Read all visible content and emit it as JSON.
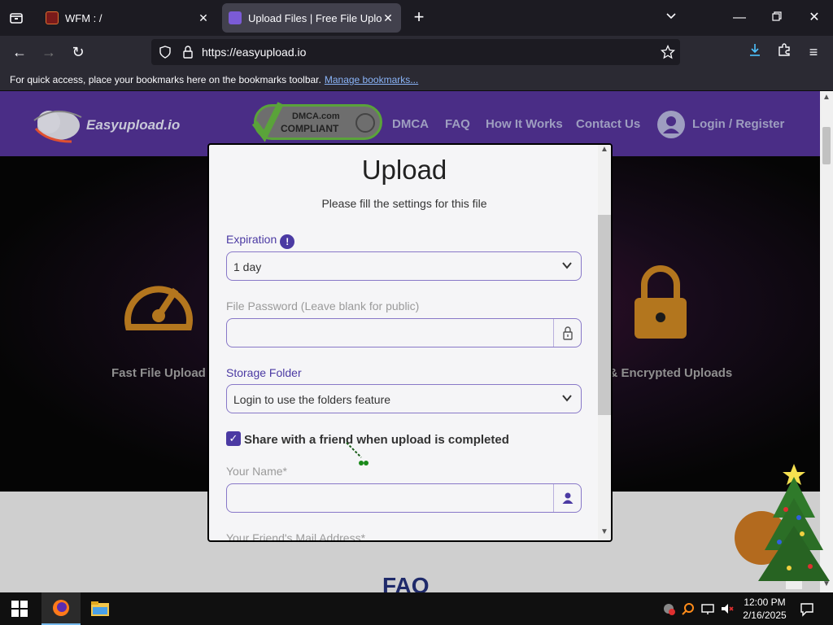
{
  "browser": {
    "tabs": [
      {
        "title": "WFM : /",
        "active": false
      },
      {
        "title": "Upload Files | Free File Upload a",
        "active": true
      }
    ],
    "url": "https://easyupload.io",
    "bookmarks_hint": "For quick access, place your bookmarks here on the bookmarks toolbar.",
    "bookmarks_link": "Manage bookmarks..."
  },
  "site": {
    "logo": "Easyupload.io",
    "dmca_line1": "DMCA.com",
    "dmca_line2": "COMPLIANT",
    "menu": [
      "DMCA",
      "FAQ",
      "How It Works",
      "Contact Us"
    ],
    "login": "Login / Register",
    "feature_left": "Fast File Upload",
    "feature_right": "e & Encrypted Uploads",
    "faq_heading": "FAQ"
  },
  "modal": {
    "title": "Upload",
    "subtitle": "Please fill the settings for this file",
    "expiration_label": "Expiration",
    "expiration_value": "1 day",
    "password_label": "File Password (Leave blank for public)",
    "storage_label": "Storage Folder",
    "storage_value": "Login to use the folders feature",
    "share_label": "Share with a friend when upload is completed",
    "your_name_label": "Your Name*",
    "friend_mail_label": "Your Friend's Mail Address*"
  },
  "taskbar": {
    "time": "12:00 PM",
    "date": "2/16/2025"
  },
  "colors": {
    "header_purple": "#4a2d86",
    "accent_purple": "#4b3aa3"
  }
}
